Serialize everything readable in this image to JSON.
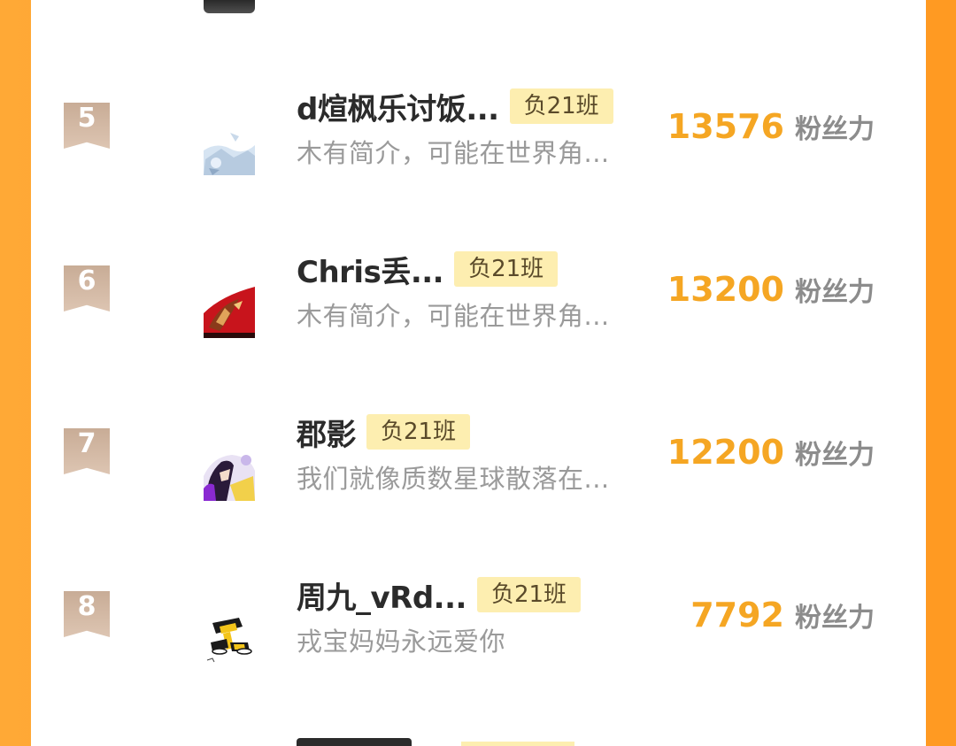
{
  "ranking": {
    "rows": [
      {
        "rank": "5",
        "name": "d煊枫乐讨饭...",
        "class_tag": "负21班",
        "bio": "木有简介，可能在世界角...",
        "score": "13576",
        "score_unit": "粉丝力",
        "avatar_icon": "snow-landscape-avatar"
      },
      {
        "rank": "6",
        "name": "Chris丢...",
        "class_tag": "负21班",
        "bio": "木有简介，可能在世界角...",
        "score": "13200",
        "score_unit": "粉丝力",
        "avatar_icon": "red-anime-avatar"
      },
      {
        "rank": "7",
        "name": "郡影",
        "class_tag": "负21班",
        "bio": "我们就像质数星球散落在...",
        "score": "12200",
        "score_unit": "粉丝力",
        "avatar_icon": "purple-anime-avatar"
      },
      {
        "rank": "8",
        "name": "周九_vRd...",
        "class_tag": "负21班",
        "bio": "戎宝妈妈永远爱你",
        "score": "7792",
        "score_unit": "粉丝力",
        "avatar_icon": "yellow-cartoon-avatar"
      }
    ]
  },
  "colors": {
    "border_orange": "#ff9f2a",
    "score_orange": "#f5a623",
    "tag_bg": "#fdeeb0",
    "badge_tan": "#c8ac96"
  }
}
